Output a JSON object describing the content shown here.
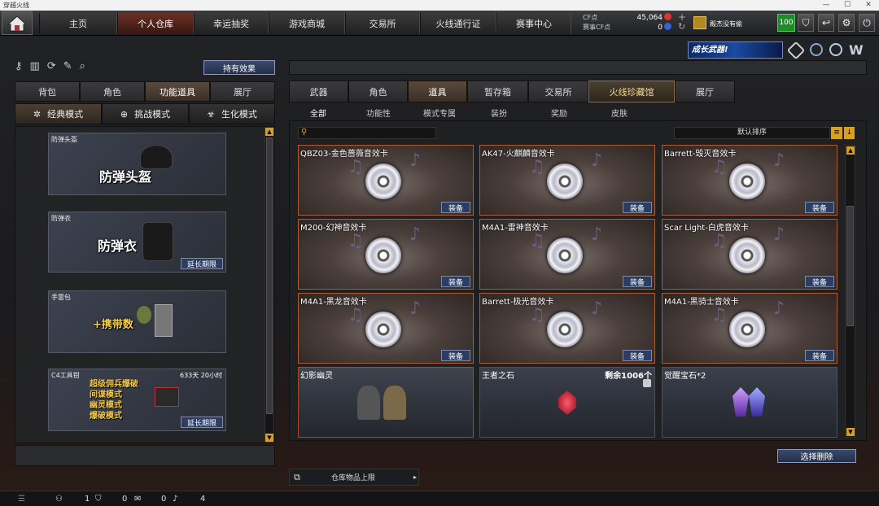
{
  "window": {
    "title": "穿越火线"
  },
  "topnav": {
    "tabs": [
      "主页",
      "个人仓库",
      "幸运抽奖",
      "游戏商城",
      "交易所",
      "火线通行证",
      "赛事中心"
    ],
    "active": 1
  },
  "currency": {
    "cf_label": "CF点",
    "cf_value": "45,064",
    "event_cf_label": "赛事CF点",
    "event_cf_value": "0"
  },
  "user": {
    "guild": "殿杰没有偷",
    "level": "100"
  },
  "banner": {
    "text": "成长武器!"
  },
  "left": {
    "effect_button": "持有效果",
    "tabs": [
      "背包",
      "角色",
      "功能道具",
      "展厅"
    ],
    "active_tab": 2,
    "modes": [
      "经典模式",
      "挑战模式",
      "生化模式"
    ],
    "items": [
      {
        "label": "防弹头盔",
        "big": "防弹头盔",
        "button": ""
      },
      {
        "label": "防弹衣",
        "big": "防弹衣",
        "button": "延长期限"
      },
      {
        "label": "手雷包",
        "big": "+携带数",
        "button": ""
      },
      {
        "label": "C4工具钳",
        "big": "超级佣兵爆破",
        "lines": [
          "间谍模式",
          "幽灵模式",
          "爆破模式"
        ],
        "time": "633天 20小时",
        "button": "延长期限"
      }
    ]
  },
  "right": {
    "tabs": [
      "武器",
      "角色",
      "道具",
      "暂存箱",
      "交易所",
      "火线珍藏馆",
      "展厅"
    ],
    "active_tab": 2,
    "subtabs": [
      "全部",
      "功能性",
      "模式专属",
      "装扮",
      "奖励",
      "皮肤"
    ],
    "sort": "默认排序",
    "search_placeholder": "",
    "equip_label": "装备",
    "cards": [
      "QBZ03-金色蔷薇音效卡",
      "AK47-火麒麟音效卡",
      "Barrett-毁灭音效卡",
      "M200-幻神音效卡",
      "M4A1-雷神音效卡",
      "Scar Light-白虎音效卡",
      "M4A1-黑龙音效卡",
      "Barrett-极光音效卡",
      "M4A1-黑骑士音效卡"
    ],
    "extra_cards": [
      {
        "name": "幻影幽灵",
        "extra": ""
      },
      {
        "name": "王者之石",
        "extra": "剩余1006个"
      },
      {
        "name": "觉醒宝石*2",
        "extra": ""
      }
    ],
    "select_delete": "选择删除",
    "storage_limit": "仓库物品上限"
  },
  "statusbar": {
    "values": [
      "1",
      "0",
      "0",
      "4"
    ]
  }
}
